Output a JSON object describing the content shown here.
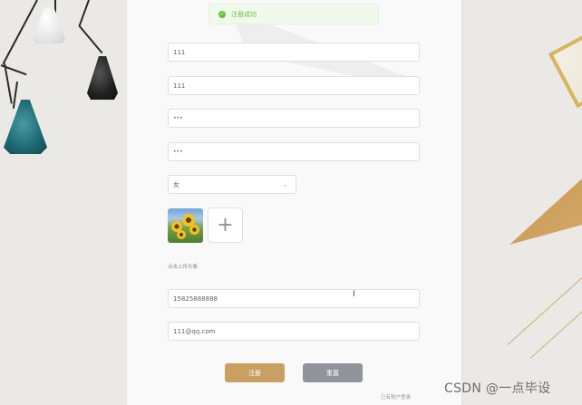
{
  "toast": {
    "icon": "check-circle-icon",
    "message": "注册成功",
    "color": "#67c23a"
  },
  "form": {
    "username": "111",
    "nickname": "111",
    "password": "•••",
    "confirm_password": "•••",
    "gender": "女",
    "avatar_hint": "点击上传头像",
    "phone": "15825888888",
    "email": "111@qq.com"
  },
  "buttons": {
    "register": "注册",
    "reset": "重置"
  },
  "login_link": "已有账户登录",
  "watermark": "CSDN @一点毕设",
  "colors": {
    "register_button": "#c9a062",
    "reset_button": "#909399"
  }
}
